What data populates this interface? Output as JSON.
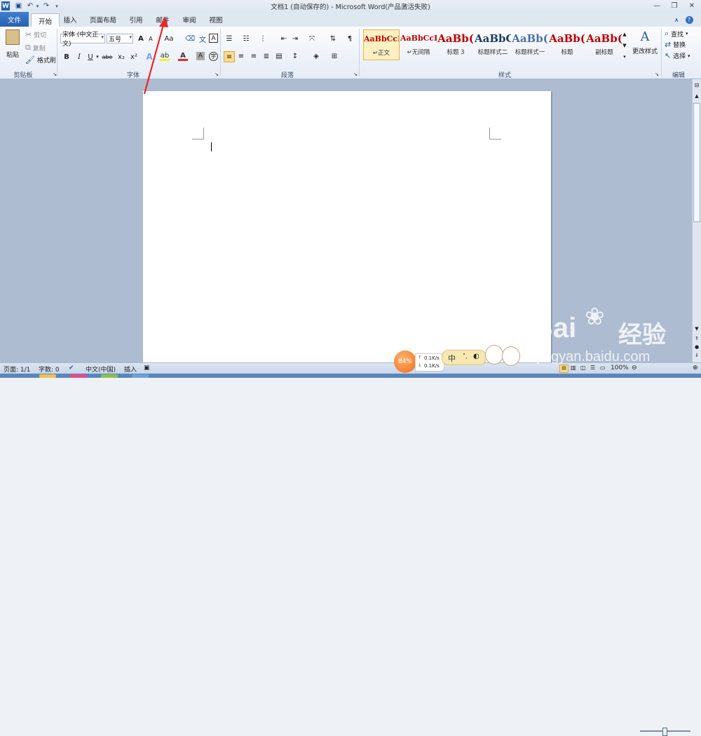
{
  "title_bar": {
    "title": "文档1 (自动保存的) - Microsoft Word(产品激活失败)",
    "quick_access": [
      "word-app-icon",
      "save-icon",
      "undo-icon",
      "undo-dropdown-icon",
      "redo-icon",
      "customize-qat-icon"
    ],
    "window_buttons": [
      "minimize-icon",
      "restore-icon",
      "close-icon"
    ],
    "minimize": "—",
    "restore": "❐",
    "close": "✕"
  },
  "tabs": {
    "file": "文件",
    "home": "开始",
    "insert": "插入",
    "page_layout": "页面布局",
    "references": "引用",
    "mailings": "邮件",
    "review": "审阅",
    "view": "视图"
  },
  "clipboard": {
    "paste": "粘贴",
    "cut": "剪切",
    "copy": "复制",
    "format_painter": "格式刷",
    "label": "剪贴板"
  },
  "font": {
    "font_name": "宋体 (中文正文)",
    "font_size": "五号",
    "grow": "A",
    "shrink": "A",
    "case": "Aa",
    "bold": "B",
    "italic": "I",
    "underline": "U",
    "strike": "abe",
    "subscript": "x₂",
    "superscript": "x²",
    "label": "字体"
  },
  "paragraph": {
    "label": "段落"
  },
  "styles": {
    "label": "样式",
    "items": [
      {
        "sample": "AaBbCcD",
        "name": "正文",
        "prefix": "↵",
        "color": "#c00000",
        "selected": true
      },
      {
        "sample": "AaBbCcD",
        "name": "无间隔",
        "prefix": "↵",
        "color": "#c00000",
        "selected": false
      },
      {
        "sample": "AaBb(",
        "name": "标题 3",
        "prefix": "",
        "color": "#c00000",
        "selected": false
      },
      {
        "sample": "AaBbC(",
        "name": "标题样式二",
        "prefix": "",
        "color": "#1f3b66",
        "selected": false
      },
      {
        "sample": "AaBb(",
        "name": "标题样式一",
        "prefix": "",
        "color": "#4b6fa8",
        "selected": false
      },
      {
        "sample": "AaBb(",
        "name": "标题",
        "prefix": "",
        "color": "#c00000",
        "selected": false
      },
      {
        "sample": "AaBb(",
        "name": "副标题",
        "prefix": "",
        "color": "#c00000",
        "selected": false
      }
    ],
    "change_styles": "更改样式"
  },
  "editing": {
    "find": "查找",
    "replace": "替换",
    "select": "选择",
    "label": "编辑"
  },
  "statusbar": {
    "page": "页面: 1/1",
    "words": "字数: 0",
    "language": "中文(中国)",
    "mode": "插入",
    "zoom": "100%"
  },
  "overlay": {
    "speed_percent": "84%",
    "upload": "0.1K/s",
    "download": "0.1K/s",
    "ime_label": "中",
    "watermark_brand": "Bai",
    "watermark_cn": "经验",
    "watermark_url": "jingyan.baidu.com"
  },
  "colors": {
    "accent_blue": "#2a5fae",
    "annotation_red": "#e8262a",
    "style_red": "#c00000"
  }
}
